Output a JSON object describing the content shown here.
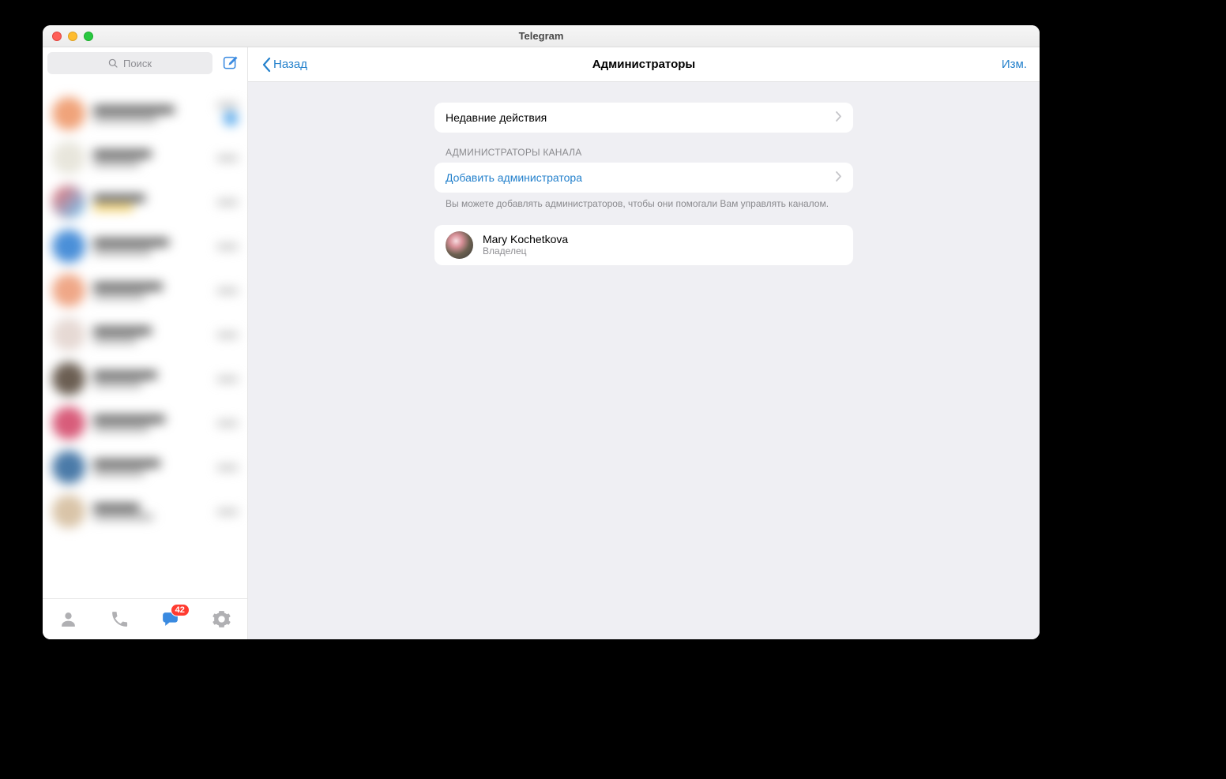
{
  "window": {
    "title": "Telegram"
  },
  "sidebar": {
    "search_placeholder": "Поиск",
    "tabs": {
      "chats_badge": "42"
    }
  },
  "header": {
    "back_label": "Назад",
    "title": "Администраторы",
    "edit_label": "Изм."
  },
  "sections": {
    "recent_actions": "Недавние действия",
    "admins_header": "АДМИНИСТРАТОРЫ КАНАЛА",
    "add_admin": "Добавить администратора",
    "add_admin_footer": "Вы можете добавлять администраторов, чтобы они помогали Вам управлять каналом."
  },
  "admins": [
    {
      "name": "Mary Kochetkova",
      "role": "Владелец"
    }
  ]
}
